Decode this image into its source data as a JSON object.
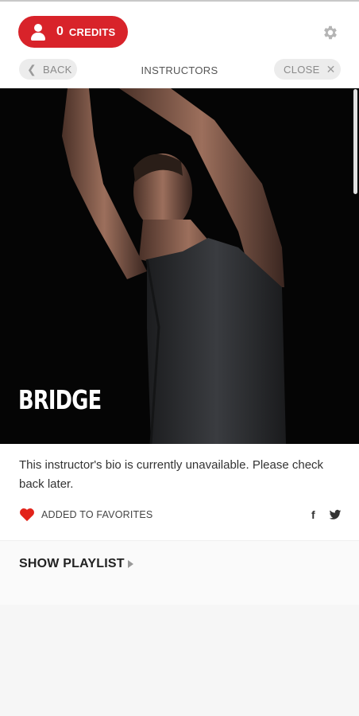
{
  "header": {
    "credits_count": "0",
    "credits_label": "CREDITS",
    "nav_title": "INSTRUCTORS",
    "back_label": "BACK",
    "close_label": "CLOSE"
  },
  "instructor": {
    "name": "BRIDGE",
    "bio": "This instructor's bio is currently unavailable. Please check back later."
  },
  "favorites": {
    "label": "ADDED TO FAVORITES",
    "icon": "heart-icon"
  },
  "social": {
    "facebook": "f",
    "twitter_icon": "twitter-icon"
  },
  "playlist": {
    "label": "SHOW PLAYLIST"
  },
  "colors": {
    "brand_red": "#d8232a",
    "hero_bg": "#050505"
  }
}
